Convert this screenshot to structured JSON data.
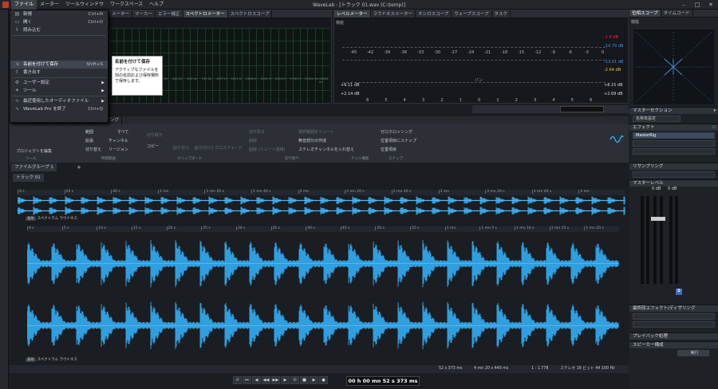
{
  "window": {
    "title": "WaveLab - [トラック 01.wav (C:\\temp)]"
  },
  "menubar": [
    "ファイル",
    "メーター",
    "ツールウィンドウ",
    "ワークスペース",
    "ヘルプ"
  ],
  "file_menu": {
    "items": [
      {
        "label": "新規",
        "shortcut": "Ctrl+N",
        "state": "normal"
      },
      {
        "label": "開く",
        "shortcut": "Ctrl+O",
        "state": "normal"
      },
      {
        "label": "読み込む",
        "shortcut": "",
        "state": "normal"
      },
      {
        "label": "",
        "shortcut": "",
        "state": "disabled"
      },
      {
        "label": "",
        "shortcut": "",
        "state": "disabled"
      },
      {
        "label": "",
        "shortcut": "",
        "state": "disabled"
      },
      {
        "label": "名前を付けて保存",
        "shortcut": "Shift+S",
        "state": "highlight"
      },
      {
        "label": "書き出す",
        "shortcut": "",
        "state": "normal"
      },
      {
        "label": "ユーザー設定",
        "shortcut": "",
        "state": "submenu"
      },
      {
        "label": "ツール",
        "shortcut": "",
        "state": "submenu"
      },
      {
        "label": "最近使用したオーディオファイル",
        "shortcut": "",
        "state": "submenu"
      },
      {
        "label": "WaveLab Pro を終了",
        "shortcut": "Ctrl+Q",
        "state": "normal"
      }
    ]
  },
  "tooltip": {
    "title": "名前を付けて保存",
    "body": "アクティブなファイルを別の名前および保存場所で保存します。"
  },
  "top_left_tabs": [
    "メーター",
    "マーカー",
    "エラー補正",
    "スペクトロメーター",
    "スペクトロスコープ"
  ],
  "spectrum_freqs": [
    "58 Hz",
    "71 Hz",
    "86 Hz",
    "105 Hz",
    "128 Hz",
    "156 Hz",
    "189 Hz",
    "230 Hz",
    "279 Hz",
    "340 Hz",
    "413 Hz",
    "502 Hz",
    "611 Hz",
    "743 Hz",
    "902 Hz",
    "1097 Hz",
    "1333 Hz",
    "1621 Hz",
    "1971 Hz",
    "2396 Hz",
    "2913 Hz",
    "3541 Hz",
    "4305 Hz",
    "5234 Hz",
    "6363 Hz",
    "7736 Hz",
    "9405 Hz",
    "11434 Hz",
    "13901 Hz",
    "16900 Hz"
  ],
  "level_meter": {
    "tabs": [
      "レベルメーター",
      "ラウドネスメーター",
      "オシロスコープ",
      "ウェーブスコープ",
      "タスク"
    ],
    "scale": [
      "-45",
      "-42",
      "-39",
      "-36",
      "-33",
      "-30",
      "-27",
      "-24",
      "-21",
      "-18",
      "-15",
      "-12",
      "-9",
      "-6",
      "-3",
      "0"
    ],
    "left_readouts": [
      "+6.11 dB",
      "+2.14 dB"
    ],
    "right_readouts": [
      "-1.8 dB",
      "-14.79 dB",
      "-13.01 dB",
      "-2.64 dB",
      "+8.15 dB",
      "+2.69 dB"
    ],
    "pan_label": "パン",
    "pan_scale": [
      "8",
      "5",
      "4",
      "3",
      "2",
      "1",
      "0",
      "1",
      "2",
      "3",
      "4",
      "5",
      "8"
    ],
    "mode_label": "機能"
  },
  "phase_scope": {
    "tabs": [
      "位相スコープ",
      "タイムコード"
    ],
    "mode_label": "機能"
  },
  "master_section": {
    "title": "マスターセクション",
    "preset_label": "名称未設定",
    "effects_label": "エフェクト",
    "plugin": "MasterRig",
    "resampling": "リサンプリング",
    "master_level": "マスターレベル",
    "level_values": [
      "0 dB",
      "0 dB"
    ],
    "last_effects": "最終段エフェクト/ディザリング",
    "playback": "プレイバック処理",
    "speaker": "スピーカー構成",
    "render": "実行"
  },
  "editor": {
    "tabs": [
      "ファイル",
      "表示",
      "挿入",
      "処理",
      "解析",
      "レンダリング"
    ],
    "ribbon": {
      "buttons": [
        "プロジェクトを編集",
        "範囲",
        "拡張",
        "切り替え",
        "すべて",
        "チャンネル",
        "リージョン",
        "切り取り",
        "コピー",
        "貼り付け",
        "貼り付けとクロスフェード",
        "切り取る",
        "削除",
        "削除 (ミュート適用)",
        "選択範囲をミュート",
        "無音部分の作成",
        "ステレオチャンネルを入れ替え",
        "ゼロクロッシング",
        "位置項目にスナップ",
        "位置項目"
      ],
      "groups": [
        "ツール",
        "時間範囲",
        "クリップボード",
        "切り取り",
        "ナッジ機能",
        "スナップ"
      ]
    },
    "file_group_tab": "ファイルグループ 1",
    "track_tab": "トラック 01",
    "overview_ruler": [
      "0 s",
      "20 s",
      "40 s",
      "1 mn",
      "1 mn 20 s",
      "1 mn 40 s",
      "2 mn",
      "2 mn 20 s",
      "2 mn 40 s",
      "3 mn",
      "3 mn 20 s",
      "3 mn 40 s",
      "4 mn"
    ],
    "main_ruler": [
      "0 s",
      "5 s",
      "10 s",
      "15 s",
      "20 s",
      "25 s",
      "30 s",
      "35 s",
      "40 s",
      "45 s",
      "50 s",
      "55 s",
      "1 mn",
      "1 mn 5 s",
      "1 mn 10 s",
      "1 mn 15 s",
      "1 mn 20 s"
    ],
    "view_tabs": [
      "波形",
      "スペクトラム",
      "ラウドネス"
    ],
    "status": {
      "cursor": "52 s 373 ms",
      "length": "4 mn 20 s 440 ms",
      "zoom": "1 : 1.778",
      "format": "ステレオ 16 ビット 44 100 Hz"
    }
  },
  "transport": {
    "time": "00 h 00 mn 52 s 373 ms"
  }
}
